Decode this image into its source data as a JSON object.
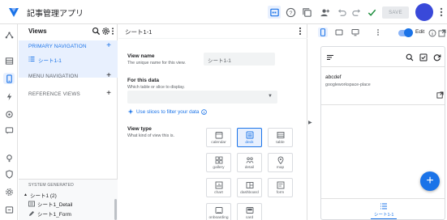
{
  "header": {
    "app_title": "記事管理アプリ",
    "save_label": "SAVE",
    "colors": {
      "accent": "#1a73e8",
      "avatar": "#3949d9",
      "check": "#1e8e3e"
    }
  },
  "views_panel": {
    "title": "Views",
    "primary_navigation": "PRIMARY NAVIGATION",
    "primary_item": "シート1-1",
    "menu_navigation": "MENU NAVIGATION",
    "reference_views": "REFERENCE VIEWS",
    "add": "+",
    "system_generated": {
      "label": "SYSTEM GENERATED",
      "group": "シート1 (2)",
      "items": [
        "シート1_Detail",
        "シート1_Form"
      ]
    }
  },
  "editor": {
    "title": "シート1-1",
    "view_name_label": "View name",
    "view_name_help": "The unique name for this view.",
    "view_name_value": "シート1-1",
    "for_data_label": "For this data",
    "for_data_help": "Which table or slice to display.",
    "for_data_value": "",
    "slice_link": "Use slices to filter your data",
    "view_type_label": "View type",
    "view_type_help": "What kind of view this is.",
    "view_types": [
      {
        "label": "calendar",
        "icon": "calendar-icon",
        "active": false
      },
      {
        "label": "deck",
        "icon": "deck-icon",
        "active": true
      },
      {
        "label": "table",
        "icon": "table-icon",
        "active": false
      },
      {
        "label": "gallery",
        "icon": "gallery-icon",
        "active": false
      },
      {
        "label": "detail",
        "icon": "detail-icon",
        "active": false
      },
      {
        "label": "map",
        "icon": "map-icon",
        "active": false
      },
      {
        "label": "chart",
        "icon": "chart-icon",
        "active": false
      },
      {
        "label": "dashboard",
        "icon": "dashboard-icon",
        "active": false
      },
      {
        "label": "form",
        "icon": "form-icon",
        "active": false
      },
      {
        "label": "onboarding",
        "icon": "onboarding-icon",
        "active": false
      },
      {
        "label": "card",
        "icon": "card-icon",
        "active": false
      }
    ]
  },
  "preview": {
    "edit_label": "Edit",
    "edit_toggle_on": true,
    "record_title": "abcdef",
    "record_subtitle": "googleworkspace-place",
    "bottom_nav_label": "シート1-1",
    "fab_label": "+"
  }
}
